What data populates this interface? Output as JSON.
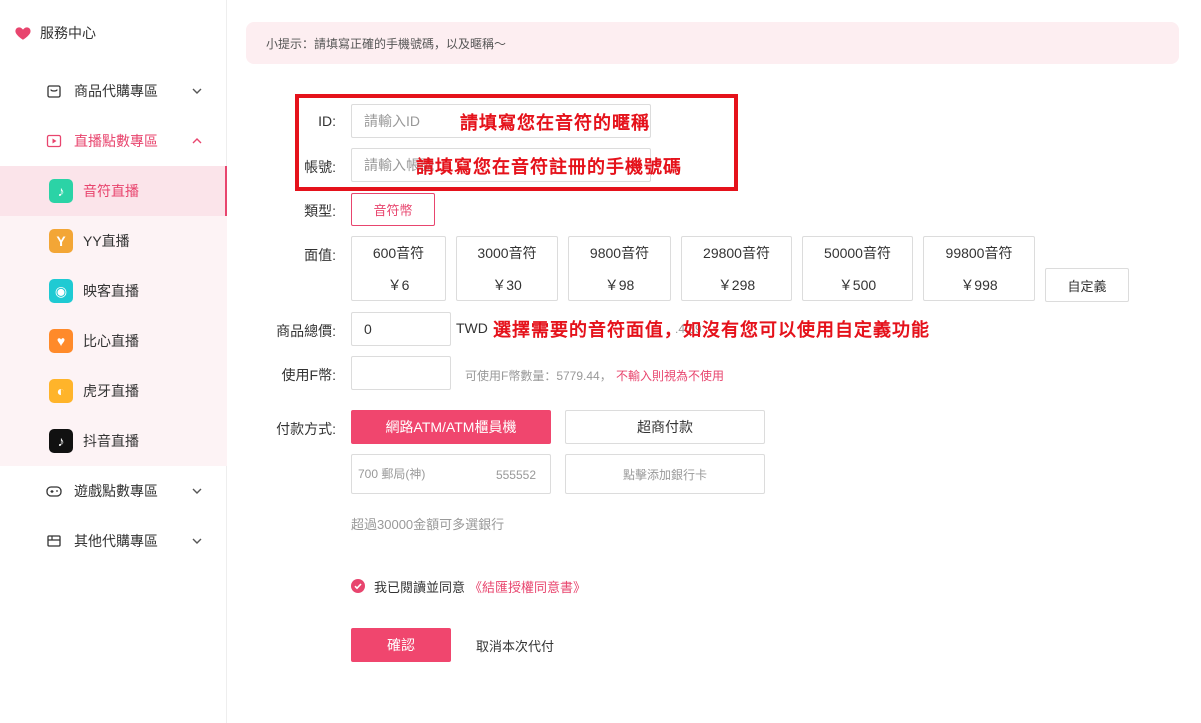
{
  "sidebar": {
    "brand": "服務中心",
    "groups": [
      {
        "label": "商品代購專區",
        "icon": "shopping-bag-icon",
        "expanded": false
      },
      {
        "label": "直播點數專區",
        "icon": "play-icon",
        "expanded": true
      },
      {
        "label": "遊戲點數專區",
        "icon": "gamepad-icon",
        "expanded": false
      },
      {
        "label": "其他代購專區",
        "icon": "box-icon",
        "expanded": false
      }
    ],
    "items": [
      {
        "label": "音符直播",
        "icon": "music-note-icon",
        "color": "#2bd3a6",
        "glyph": "♪"
      },
      {
        "label": "YY直播",
        "icon": "yy-bear-icon",
        "color": "#f3a636",
        "glyph": "Y"
      },
      {
        "label": "映客直播",
        "icon": "inke-owl-icon",
        "color": "#1fcad3",
        "glyph": "◉"
      },
      {
        "label": "比心直播",
        "icon": "bixin-heart-icon",
        "color": "#ff8a2a",
        "glyph": "♥"
      },
      {
        "label": "虎牙直播",
        "icon": "huya-icon",
        "color": "#ffb42a",
        "glyph": "◐"
      },
      {
        "label": "抖音直播",
        "icon": "douyin-icon",
        "color": "#111111",
        "glyph": "♪"
      }
    ],
    "active_item": "音符直播"
  },
  "notice": "小提示：請填寫正確的手機號碼，以及暱稱～",
  "form": {
    "id_label": "ID:",
    "id_placeholder": "請輸入ID",
    "account_label": "帳號:",
    "account_placeholder": "請輸入帳號",
    "type_label": "類型:",
    "type_value": "音符幣",
    "value_label": "面值:",
    "values": [
      {
        "coins": "600音符",
        "price": "￥6"
      },
      {
        "coins": "3000音符",
        "price": "￥30"
      },
      {
        "coins": "9800音符",
        "price": "￥98"
      },
      {
        "coins": "29800音符",
        "price": "￥298"
      },
      {
        "coins": "50000音符",
        "price": "￥500"
      },
      {
        "coins": "99800音符",
        "price": "￥998"
      }
    ],
    "custom_label": "自定義",
    "total_label": "商品總價:",
    "total_value": "0",
    "currency": "TWD",
    "rate_fragment": ".4.69",
    "f_label": "使用F幣:",
    "f_hint": "可使用F幣數量：5779.44，",
    "f_warning": "不輸入則視為不使用",
    "pay_label": "付款方式:",
    "pay_primary": "網路ATM/ATM櫃員機",
    "pay_secondary": "超商付款",
    "bank_name": "700 郵局(神)",
    "bank_number": "555552",
    "add_card": "點擊添加銀行卡",
    "multi_bank_hint": "超過30000金額可多選銀行",
    "agree_text": "我已閱讀並同意",
    "agree_link": "《結匯授權同意書》",
    "confirm": "確認",
    "cancel": "取消本次代付"
  },
  "annotations": {
    "nickname": "請填寫您在音符的暱稱",
    "phone": "請填寫您在音符註冊的手機號碼",
    "value_hint": "選擇需要的音符面值，如沒有您可以使用自定義功能"
  },
  "colors": {
    "accent": "#e8456e",
    "annotation": "#e5121b"
  }
}
